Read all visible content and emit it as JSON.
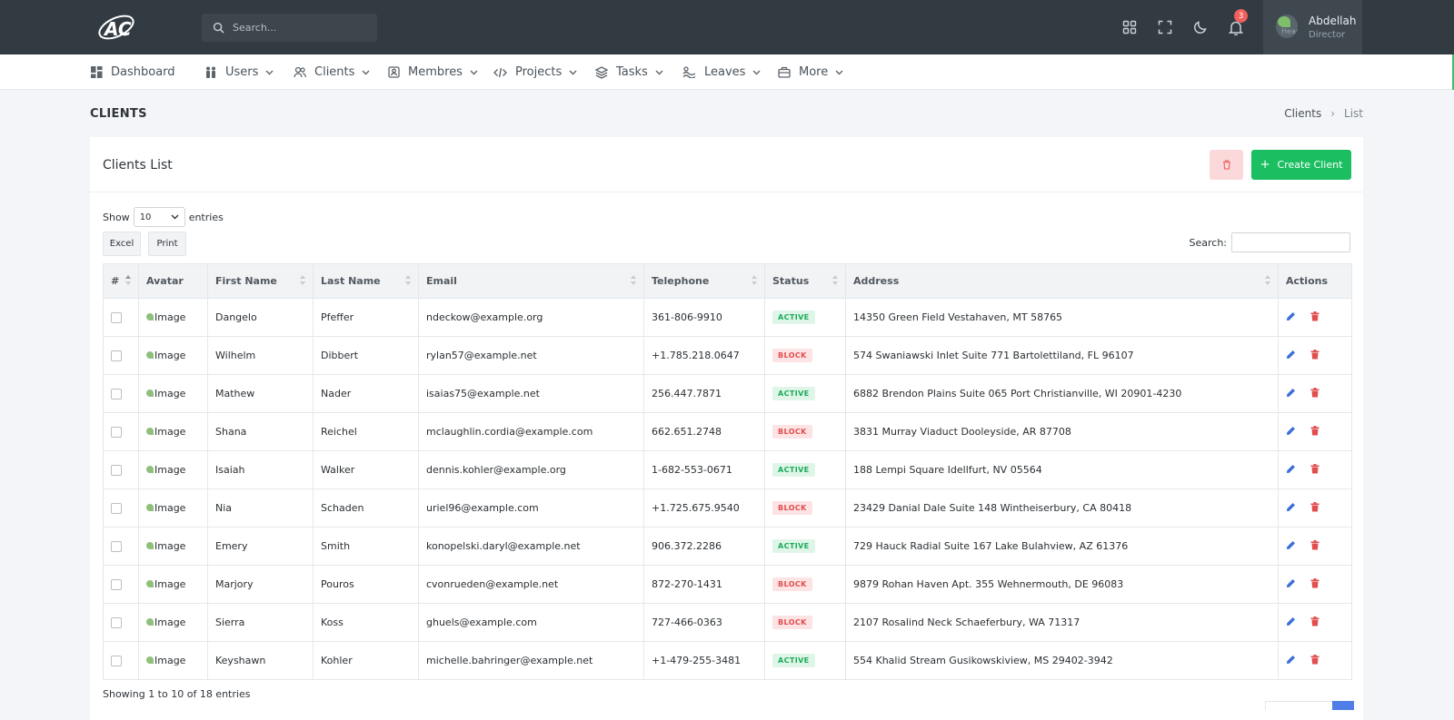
{
  "header": {
    "search_placeholder": "Search...",
    "notification_count": "3",
    "user": {
      "name": "Abdellah",
      "role": "Director",
      "avatar_alt": "Hear"
    }
  },
  "nav": {
    "items": [
      {
        "label": "Dashboard",
        "icon": "dashboard-icon",
        "has_dropdown": false
      },
      {
        "label": "Users",
        "icon": "users-icon",
        "has_dropdown": true
      },
      {
        "label": "Clients",
        "icon": "clients-icon",
        "has_dropdown": true
      },
      {
        "label": "Membres",
        "icon": "id-card-icon",
        "has_dropdown": true
      },
      {
        "label": "Projects",
        "icon": "code-icon",
        "has_dropdown": true
      },
      {
        "label": "Tasks",
        "icon": "layers-icon",
        "has_dropdown": true
      },
      {
        "label": "Leaves",
        "icon": "leaves-icon",
        "has_dropdown": true
      },
      {
        "label": "More",
        "icon": "briefcase-icon",
        "has_dropdown": true
      }
    ]
  },
  "page": {
    "title": "CLIENTS",
    "breadcrumb": [
      "Clients",
      "List"
    ]
  },
  "card": {
    "title": "Clients List",
    "create_label": "Create Client"
  },
  "table_controls": {
    "show_label": "Show",
    "entries_value": "10",
    "entries_label": "entries",
    "excel_label": "Excel",
    "print_label": "Print",
    "search_label": "Search:"
  },
  "table": {
    "columns": [
      "#",
      "Avatar",
      "First Name",
      "Last Name",
      "Email",
      "Telephone",
      "Status",
      "Address",
      "Actions"
    ],
    "image_alt": "Image",
    "rows": [
      {
        "first": "Dangelo",
        "last": "Pfeffer",
        "email": "ndeckow@example.org",
        "phone": "361-806-9910",
        "status": "ACTIVE",
        "address": "14350 Green Field Vestahaven, MT 58765"
      },
      {
        "first": "Wilhelm",
        "last": "Dibbert",
        "email": "rylan57@example.net",
        "phone": "+1.785.218.0647",
        "status": "BLOCK",
        "address": "574 Swaniawski Inlet Suite 771 Bartolettiland, FL 96107"
      },
      {
        "first": "Mathew",
        "last": "Nader",
        "email": "isaias75@example.net",
        "phone": "256.447.7871",
        "status": "ACTIVE",
        "address": "6882 Brendon Plains Suite 065 Port Christianville, WI 20901-4230"
      },
      {
        "first": "Shana",
        "last": "Reichel",
        "email": "mclaughlin.cordia@example.com",
        "phone": "662.651.2748",
        "status": "BLOCK",
        "address": "3831 Murray Viaduct Dooleyside, AR 87708"
      },
      {
        "first": "Isaiah",
        "last": "Walker",
        "email": "dennis.kohler@example.org",
        "phone": "1-682-553-0671",
        "status": "ACTIVE",
        "address": "188 Lempi Square Idellfurt, NV 05564"
      },
      {
        "first": "Nia",
        "last": "Schaden",
        "email": "uriel96@example.com",
        "phone": "+1.725.675.9540",
        "status": "BLOCK",
        "address": "23429 Danial Dale Suite 148 Wintheiserbury, CA 80418"
      },
      {
        "first": "Emery",
        "last": "Smith",
        "email": "konopelski.daryl@example.net",
        "phone": "906.372.2286",
        "status": "ACTIVE",
        "address": "729 Hauck Radial Suite 167 Lake Bulahview, AZ 61376"
      },
      {
        "first": "Marjory",
        "last": "Pouros",
        "email": "cvonrueden@example.net",
        "phone": "872-270-1431",
        "status": "BLOCK",
        "address": "9879 Rohan Haven Apt. 355 Wehnermouth, DE 96083"
      },
      {
        "first": "Sierra",
        "last": "Koss",
        "email": "ghuels@example.com",
        "phone": "727-466-0363",
        "status": "BLOCK",
        "address": "2107 Rosalind Neck Schaeferbury, WA 71317"
      },
      {
        "first": "Keyshawn",
        "last": "Kohler",
        "email": "michelle.bahringer@example.net",
        "phone": "+1-479-255-3481",
        "status": "ACTIVE",
        "address": "554 Khalid Stream Gusikowskiview, MS 29402-3942"
      }
    ]
  },
  "footer": {
    "info": "Showing 1 to 10 of 18 entries"
  },
  "colors": {
    "header_bg": "#323b42",
    "accent_green": "#1bbf61",
    "danger": "#e24d4d",
    "edit_blue": "#3b6fd8"
  }
}
